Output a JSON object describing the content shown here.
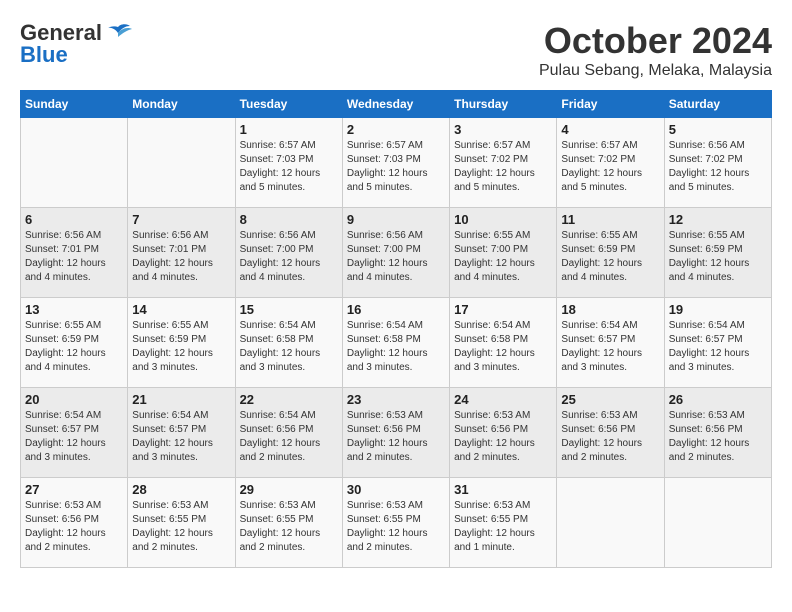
{
  "header": {
    "logo_line1": "General",
    "logo_line2": "Blue",
    "month": "October 2024",
    "location": "Pulau Sebang, Melaka, Malaysia"
  },
  "days_of_week": [
    "Sunday",
    "Monday",
    "Tuesday",
    "Wednesday",
    "Thursday",
    "Friday",
    "Saturday"
  ],
  "weeks": [
    [
      {
        "day": "",
        "info": ""
      },
      {
        "day": "",
        "info": ""
      },
      {
        "day": "1",
        "info": "Sunrise: 6:57 AM\nSunset: 7:03 PM\nDaylight: 12 hours\nand 5 minutes."
      },
      {
        "day": "2",
        "info": "Sunrise: 6:57 AM\nSunset: 7:03 PM\nDaylight: 12 hours\nand 5 minutes."
      },
      {
        "day": "3",
        "info": "Sunrise: 6:57 AM\nSunset: 7:02 PM\nDaylight: 12 hours\nand 5 minutes."
      },
      {
        "day": "4",
        "info": "Sunrise: 6:57 AM\nSunset: 7:02 PM\nDaylight: 12 hours\nand 5 minutes."
      },
      {
        "day": "5",
        "info": "Sunrise: 6:56 AM\nSunset: 7:02 PM\nDaylight: 12 hours\nand 5 minutes."
      }
    ],
    [
      {
        "day": "6",
        "info": "Sunrise: 6:56 AM\nSunset: 7:01 PM\nDaylight: 12 hours\nand 4 minutes."
      },
      {
        "day": "7",
        "info": "Sunrise: 6:56 AM\nSunset: 7:01 PM\nDaylight: 12 hours\nand 4 minutes."
      },
      {
        "day": "8",
        "info": "Sunrise: 6:56 AM\nSunset: 7:00 PM\nDaylight: 12 hours\nand 4 minutes."
      },
      {
        "day": "9",
        "info": "Sunrise: 6:56 AM\nSunset: 7:00 PM\nDaylight: 12 hours\nand 4 minutes."
      },
      {
        "day": "10",
        "info": "Sunrise: 6:55 AM\nSunset: 7:00 PM\nDaylight: 12 hours\nand 4 minutes."
      },
      {
        "day": "11",
        "info": "Sunrise: 6:55 AM\nSunset: 6:59 PM\nDaylight: 12 hours\nand 4 minutes."
      },
      {
        "day": "12",
        "info": "Sunrise: 6:55 AM\nSunset: 6:59 PM\nDaylight: 12 hours\nand 4 minutes."
      }
    ],
    [
      {
        "day": "13",
        "info": "Sunrise: 6:55 AM\nSunset: 6:59 PM\nDaylight: 12 hours\nand 4 minutes."
      },
      {
        "day": "14",
        "info": "Sunrise: 6:55 AM\nSunset: 6:59 PM\nDaylight: 12 hours\nand 3 minutes."
      },
      {
        "day": "15",
        "info": "Sunrise: 6:54 AM\nSunset: 6:58 PM\nDaylight: 12 hours\nand 3 minutes."
      },
      {
        "day": "16",
        "info": "Sunrise: 6:54 AM\nSunset: 6:58 PM\nDaylight: 12 hours\nand 3 minutes."
      },
      {
        "day": "17",
        "info": "Sunrise: 6:54 AM\nSunset: 6:58 PM\nDaylight: 12 hours\nand 3 minutes."
      },
      {
        "day": "18",
        "info": "Sunrise: 6:54 AM\nSunset: 6:57 PM\nDaylight: 12 hours\nand 3 minutes."
      },
      {
        "day": "19",
        "info": "Sunrise: 6:54 AM\nSunset: 6:57 PM\nDaylight: 12 hours\nand 3 minutes."
      }
    ],
    [
      {
        "day": "20",
        "info": "Sunrise: 6:54 AM\nSunset: 6:57 PM\nDaylight: 12 hours\nand 3 minutes."
      },
      {
        "day": "21",
        "info": "Sunrise: 6:54 AM\nSunset: 6:57 PM\nDaylight: 12 hours\nand 3 minutes."
      },
      {
        "day": "22",
        "info": "Sunrise: 6:54 AM\nSunset: 6:56 PM\nDaylight: 12 hours\nand 2 minutes."
      },
      {
        "day": "23",
        "info": "Sunrise: 6:53 AM\nSunset: 6:56 PM\nDaylight: 12 hours\nand 2 minutes."
      },
      {
        "day": "24",
        "info": "Sunrise: 6:53 AM\nSunset: 6:56 PM\nDaylight: 12 hours\nand 2 minutes."
      },
      {
        "day": "25",
        "info": "Sunrise: 6:53 AM\nSunset: 6:56 PM\nDaylight: 12 hours\nand 2 minutes."
      },
      {
        "day": "26",
        "info": "Sunrise: 6:53 AM\nSunset: 6:56 PM\nDaylight: 12 hours\nand 2 minutes."
      }
    ],
    [
      {
        "day": "27",
        "info": "Sunrise: 6:53 AM\nSunset: 6:56 PM\nDaylight: 12 hours\nand 2 minutes."
      },
      {
        "day": "28",
        "info": "Sunrise: 6:53 AM\nSunset: 6:55 PM\nDaylight: 12 hours\nand 2 minutes."
      },
      {
        "day": "29",
        "info": "Sunrise: 6:53 AM\nSunset: 6:55 PM\nDaylight: 12 hours\nand 2 minutes."
      },
      {
        "day": "30",
        "info": "Sunrise: 6:53 AM\nSunset: 6:55 PM\nDaylight: 12 hours\nand 2 minutes."
      },
      {
        "day": "31",
        "info": "Sunrise: 6:53 AM\nSunset: 6:55 PM\nDaylight: 12 hours\nand 1 minute."
      },
      {
        "day": "",
        "info": ""
      },
      {
        "day": "",
        "info": ""
      }
    ]
  ]
}
